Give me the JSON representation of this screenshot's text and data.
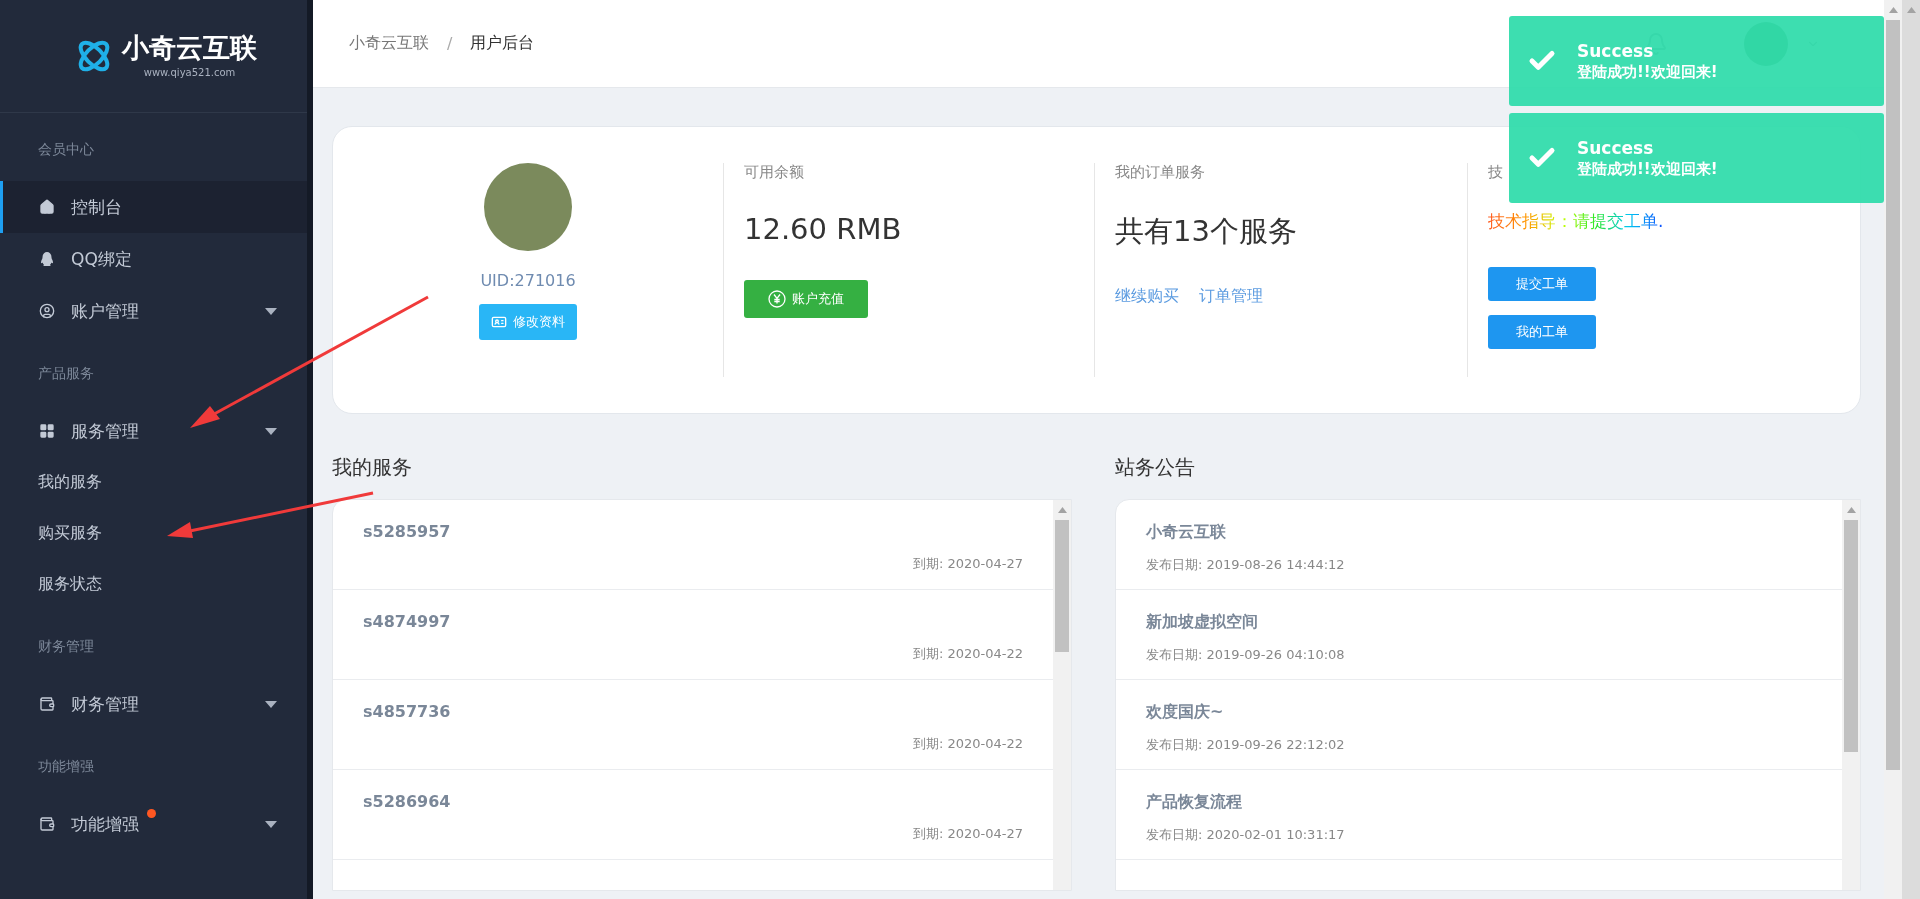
{
  "sidebar": {
    "logo": {
      "name": "小奇云互联",
      "url": "www.qiya521.com"
    },
    "groups": [
      {
        "title": "会员中心",
        "items": [
          {
            "label": "控制台",
            "kind": "home",
            "selected": true,
            "submenu": false,
            "dot": false
          },
          {
            "label": "QQ绑定",
            "kind": "qq",
            "selected": false,
            "submenu": false,
            "dot": false
          },
          {
            "label": "账户管理",
            "kind": "user",
            "selected": false,
            "submenu": true,
            "dot": false
          }
        ]
      },
      {
        "title": "产品服务",
        "items": [
          {
            "label": "服务管理",
            "kind": "grid",
            "selected": false,
            "submenu": true,
            "dot": false,
            "children": [
              {
                "label": "我的服务"
              },
              {
                "label": "购买服务"
              },
              {
                "label": "服务状态"
              }
            ]
          }
        ]
      },
      {
        "title": "财务管理",
        "items": [
          {
            "label": "财务管理",
            "kind": "wallet",
            "selected": false,
            "submenu": true,
            "dot": false
          }
        ]
      },
      {
        "title": "功能增强",
        "items": [
          {
            "label": "功能增强",
            "kind": "wallet",
            "selected": false,
            "submenu": true,
            "dot": true
          }
        ]
      }
    ]
  },
  "header": {
    "breadcrumb": [
      "小奇云互联",
      "用户后台"
    ],
    "separator": "/"
  },
  "toasts": [
    {
      "title": "Success",
      "message": "登陆成功!!欢迎回来!"
    },
    {
      "title": "Success",
      "message": "登陆成功!!欢迎回来!"
    }
  ],
  "profile": {
    "uid": "UID:271016",
    "edit_button": "修改资料"
  },
  "balance": {
    "label": "可用余额",
    "value": "12.60 RMB",
    "button": "账户充值"
  },
  "orders": {
    "label": "我的订单服务",
    "value": "共有13个服务",
    "links": [
      "继续购买",
      "订单管理"
    ]
  },
  "support": {
    "label": "技",
    "text": "技术指导：请提交工单.",
    "buttons": [
      "提交工单",
      "我的工单"
    ]
  },
  "services": {
    "title": "我的服务",
    "items": [
      {
        "id": "s5285957",
        "expiry": "到期: 2020-04-27"
      },
      {
        "id": "s4874997",
        "expiry": "到期: 2020-04-22"
      },
      {
        "id": "s4857736",
        "expiry": "到期: 2020-04-22"
      },
      {
        "id": "s5286964",
        "expiry": "到期: 2020-04-27"
      }
    ]
  },
  "announcements": {
    "title": "站务公告",
    "items": [
      {
        "title": "小奇云互联",
        "date": "发布日期: 2019-08-26 14:44:12"
      },
      {
        "title": "新加坡虚拟空间",
        "date": "发布日期: 2019-09-26 04:10:08"
      },
      {
        "title": "欢度国庆~",
        "date": "发布日期: 2019-09-26 22:12:02"
      },
      {
        "title": "产品恢复流程",
        "date": "发布日期: 2020-02-01 10:31:17"
      }
    ]
  }
}
